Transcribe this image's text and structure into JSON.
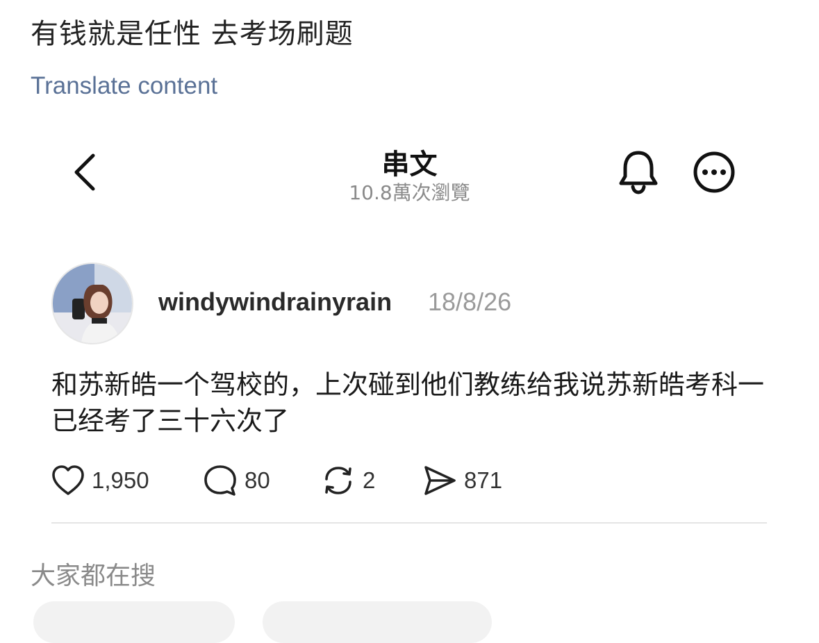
{
  "header": {
    "title": "有钱就是任性 去考场刷题",
    "translate_link": "Translate content"
  },
  "thread": {
    "title": "串文",
    "views": "10.8萬次瀏覽"
  },
  "post": {
    "username": "windywindrainyrain",
    "date": "18/8/26",
    "text": "和苏新皓一个驾校的，上次碰到他们教练给我说苏新皓考科一已经考了三十六次了",
    "likes": "1,950",
    "comments": "80",
    "reposts": "2",
    "shares": "871"
  },
  "section": {
    "title": "大家都在搜"
  },
  "icons": {
    "back": "chevron-left-icon",
    "bell": "bell-icon",
    "more": "more-icon",
    "like": "heart-icon",
    "comment": "comment-icon",
    "repost": "repost-icon",
    "share": "send-icon"
  },
  "colors": {
    "link": "#5a7196",
    "muted": "#8a8a8a"
  }
}
